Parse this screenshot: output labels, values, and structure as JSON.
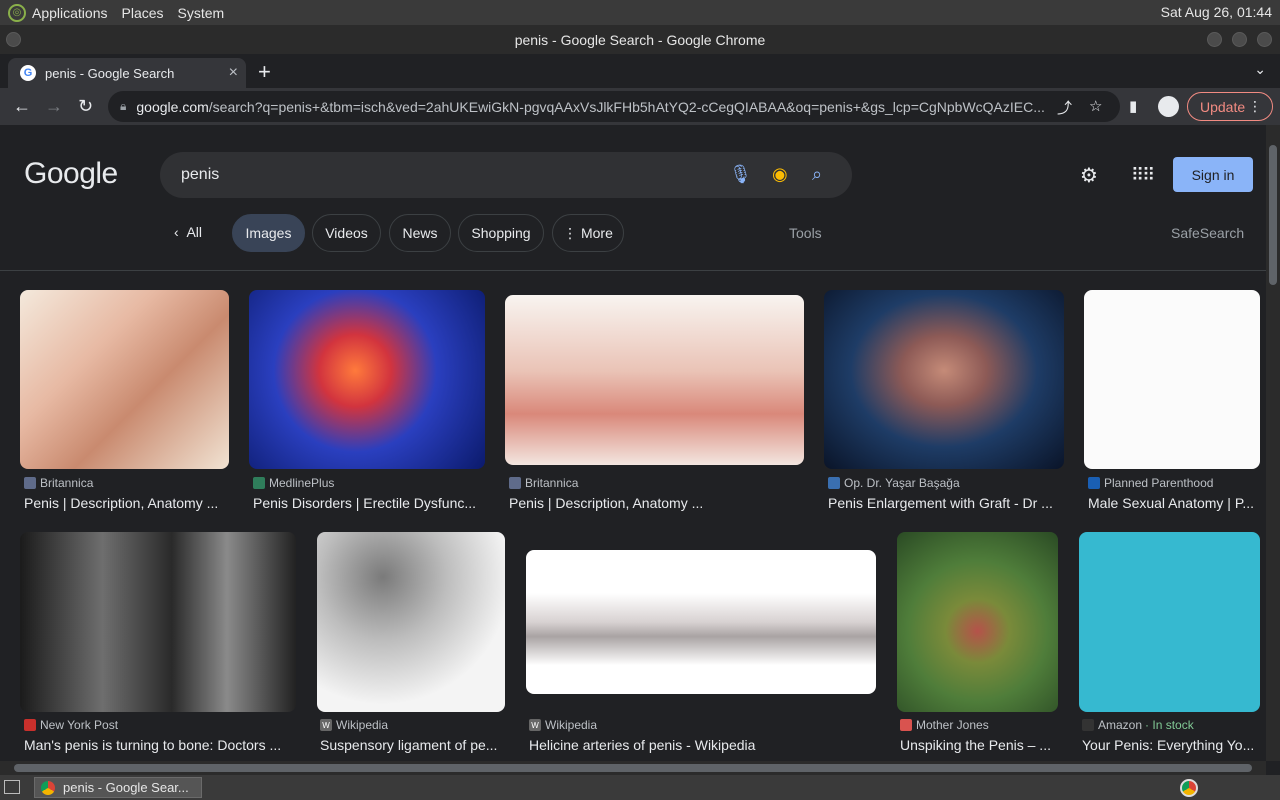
{
  "os": {
    "menus": [
      "Applications",
      "Places",
      "System"
    ],
    "clock": "Sat Aug 26, 01:44"
  },
  "window": {
    "title": "penis - Google Search - Google Chrome"
  },
  "tab": {
    "title": "penis - Google Search",
    "close": "×",
    "new_tab": "+"
  },
  "toolbar": {
    "url_host": "google.com",
    "url_path": "/search?q=penis+&tbm=isch&ved=2ahUKEwiGkN-pgvqAAxVsJlkFHb5hAtYQ2-cCegQIABAA&oq=penis+&gs_lcp=CgNpbWcQAzIEC...",
    "update_label": "Update"
  },
  "search": {
    "logo": "Google",
    "query": "penis",
    "signin": "Sign in"
  },
  "chips": {
    "all": "All",
    "items": [
      "Images",
      "Videos",
      "News",
      "Shopping",
      "More"
    ],
    "tools": "Tools",
    "safesearch": "SafeSearch"
  },
  "results": [
    {
      "source": "Britannica",
      "title": "Penis | Description, Anatomy ...",
      "fav_color": "#5f6b8a"
    },
    {
      "source": "MedlinePlus",
      "title": "Penis Disorders | Erectile Dysfunc...",
      "fav_color": "#2f7d5b"
    },
    {
      "source": "Britannica",
      "title": "Penis | Description, Anatomy ...",
      "fav_color": "#5f6b8a"
    },
    {
      "source": "Op. Dr. Yaşar Başağa",
      "title": "Penis Enlargement with Graft - Dr ...",
      "fav_color": "#3a6fb0"
    },
    {
      "source": "Planned Parenthood",
      "title": "Male Sexual Anatomy | P...",
      "fav_color": "#1a5fb4"
    },
    {
      "source": "New York Post",
      "title": "Man's penis is turning to bone: Doctors ...",
      "fav_color": "#c9302c"
    },
    {
      "source": "Wikipedia",
      "title": "Suspensory ligament of pe...",
      "fav_color": "#666666"
    },
    {
      "source": "Wikipedia",
      "title": "Helicine arteries of penis - Wikipedia",
      "fav_color": "#666666"
    },
    {
      "source": "Mother Jones",
      "title": "Unspiking the Penis – ...",
      "fav_color": "#d9534f"
    },
    {
      "source": "Amazon",
      "source_extra": "· In stock",
      "title": "Your Penis: Everything Yo...",
      "fav_color": "#333333"
    }
  ],
  "taskbar": {
    "item": "penis - Google Sear..."
  }
}
